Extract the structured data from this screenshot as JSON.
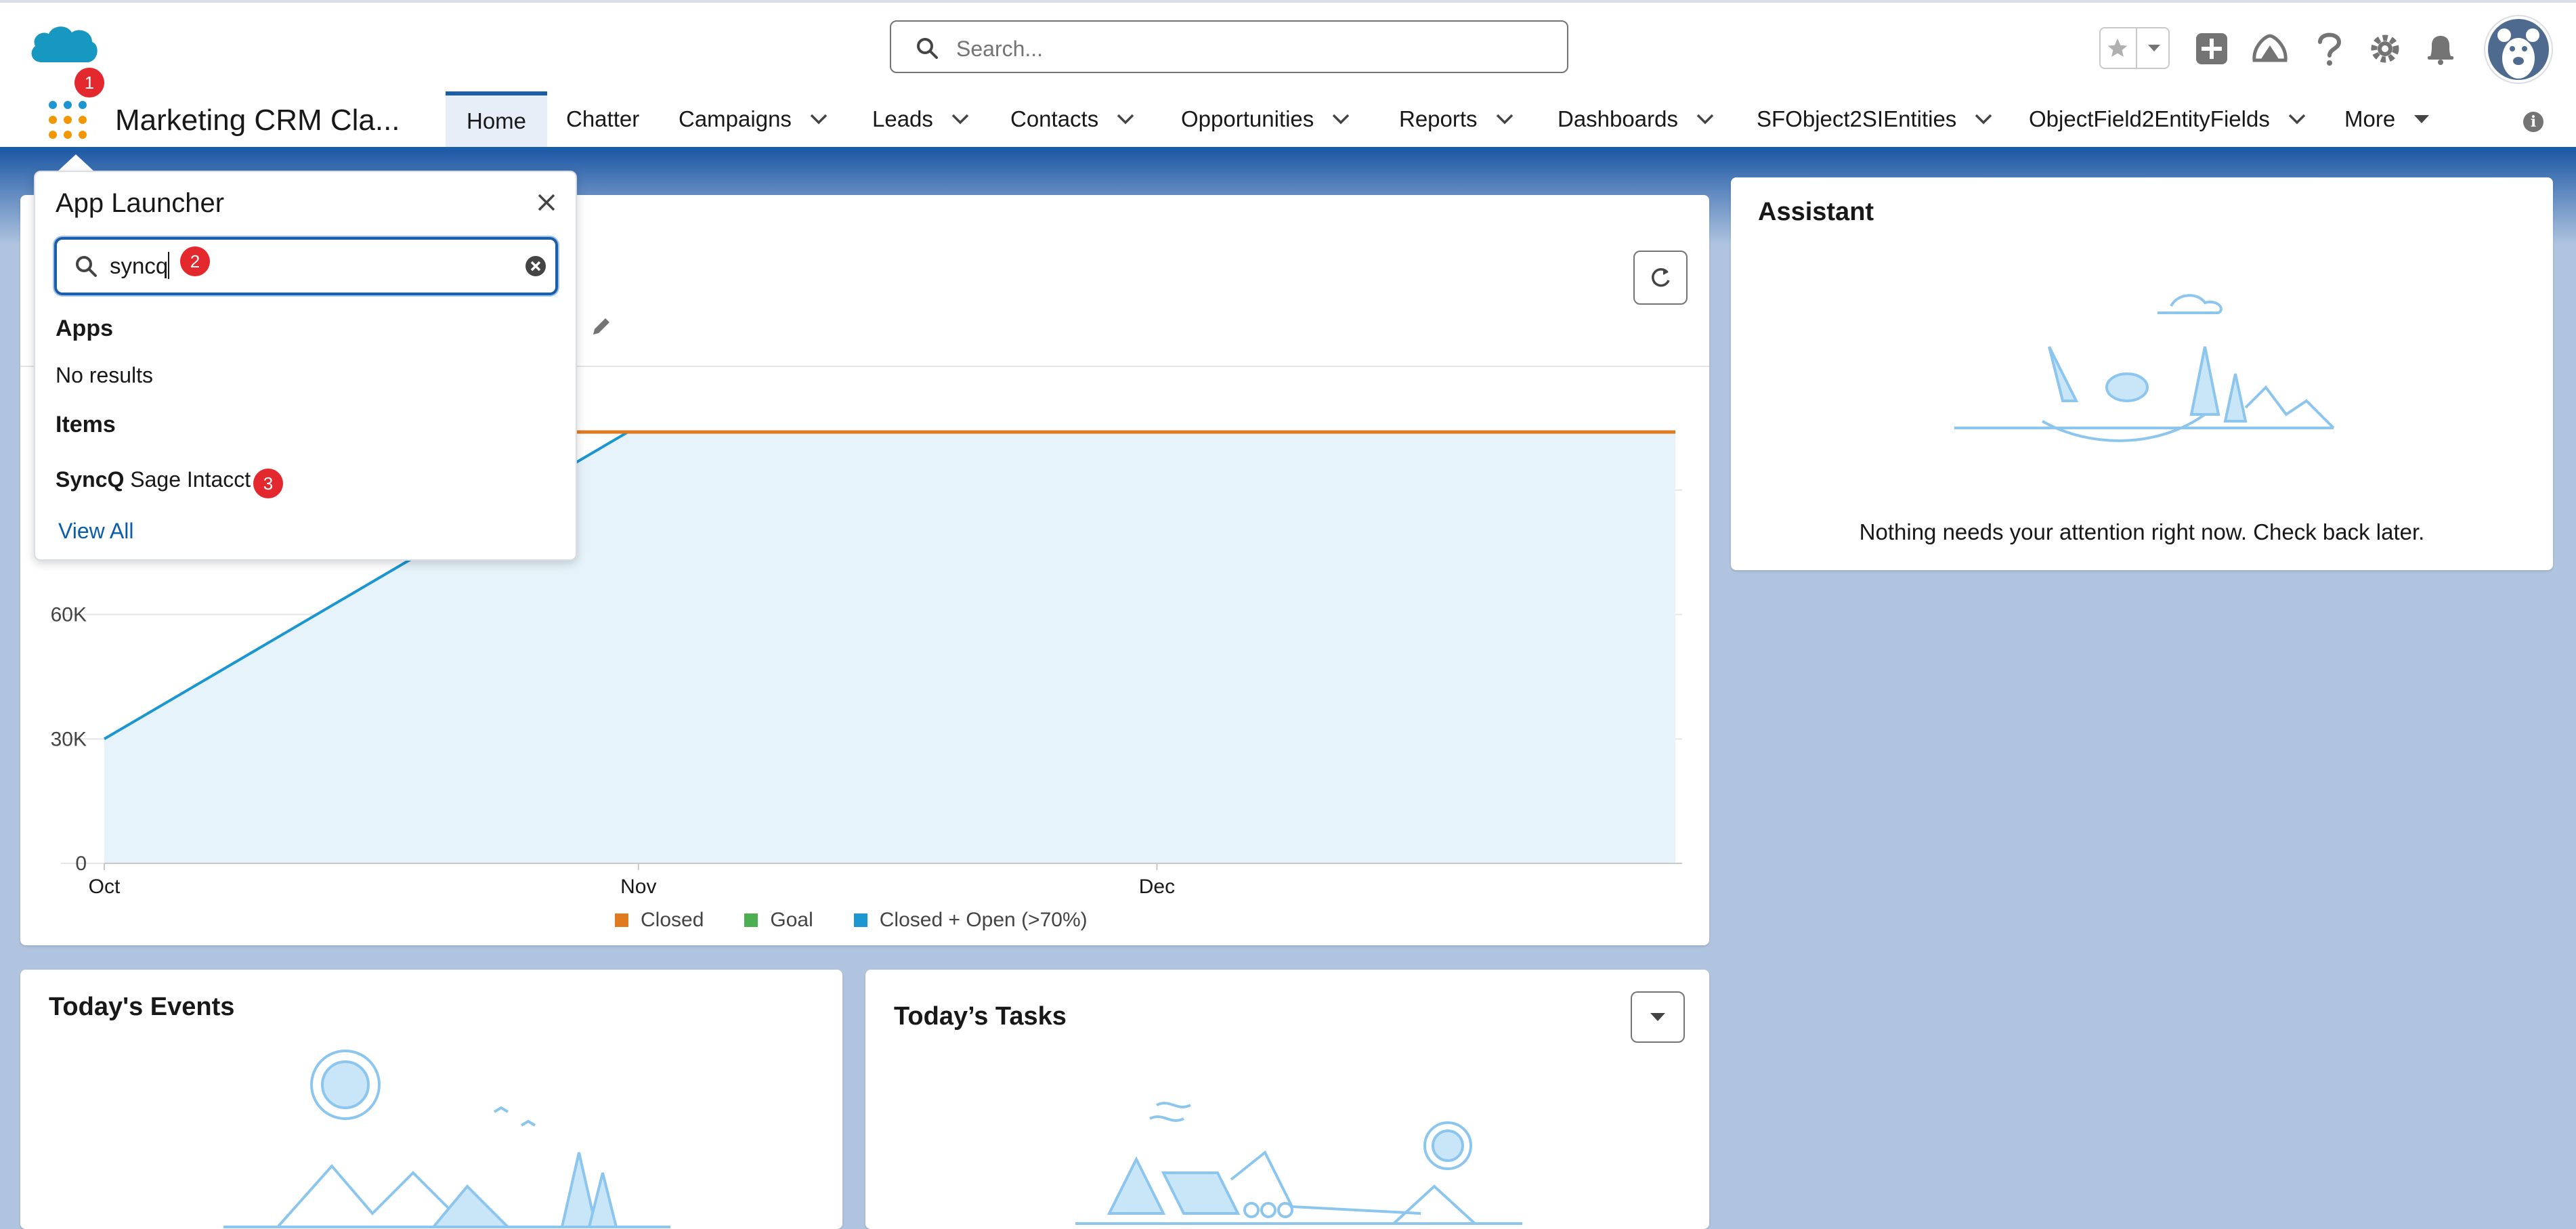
{
  "header": {
    "search_placeholder": "Search...",
    "icons": [
      "cloud-logo",
      "search-icon",
      "favorites-star-icon",
      "chevron-down-icon",
      "add-icon",
      "trailhead-icon",
      "help-icon",
      "setup-gear-icon",
      "notifications-bell-icon",
      "avatar"
    ]
  },
  "nav": {
    "app_name": "Marketing CRM Cla...",
    "items": [
      {
        "label": "Home",
        "active": true
      },
      {
        "label": "Chatter"
      },
      {
        "label": "Campaigns"
      },
      {
        "label": "Leads"
      },
      {
        "label": "Contacts"
      },
      {
        "label": "Opportunities"
      },
      {
        "label": "Reports"
      },
      {
        "label": "Dashboards"
      },
      {
        "label": "SFObject2SIEntities"
      },
      {
        "label": "ObjectField2EntityFields"
      },
      {
        "label": "More"
      }
    ]
  },
  "badges": [
    "1",
    "2",
    "3"
  ],
  "launcher": {
    "title": "App Launcher",
    "query": "syncq",
    "apps_heading": "Apps",
    "no_results": "No results",
    "items_heading": "Items",
    "item_bold": "SyncQ",
    "item_rest": " Sage Intacct",
    "view_all": "View All"
  },
  "chart_data": {
    "type": "line",
    "x_ticks": [
      "Oct",
      "Nov",
      "Dec"
    ],
    "y_ticks": [
      "0",
      "30K",
      "60K"
    ],
    "series": [
      {
        "name": "Closed",
        "color": "#e07a1f",
        "values": [
          null,
          104000,
          104000,
          104000
        ]
      },
      {
        "name": "Goal",
        "color": "#4bae4f",
        "values": []
      },
      {
        "name": "Closed + Open (>70%)",
        "color": "#1b96d1",
        "values": [
          30000,
          104000,
          104000,
          104000
        ]
      }
    ],
    "ylim": [
      0,
      120000
    ]
  },
  "assistant": {
    "title": "Assistant",
    "message": "Nothing needs your attention right now. Check back later."
  },
  "events": {
    "title": "Today's Events"
  },
  "tasks": {
    "title": "Today’s Tasks"
  }
}
